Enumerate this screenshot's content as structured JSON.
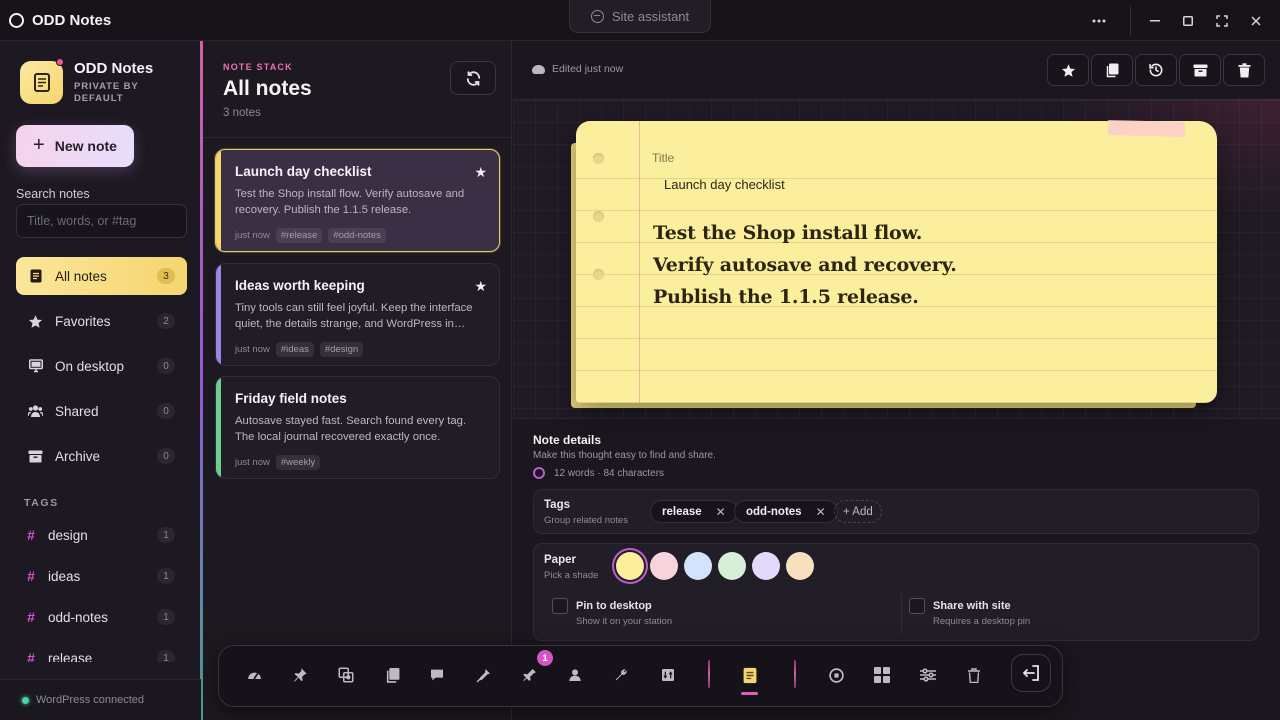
{
  "window": {
    "title": "ODD Notes",
    "site_assistant": "Site assistant"
  },
  "sidebar": {
    "brand_title": "ODD Notes",
    "brand_sub_line1": "PRIVATE BY",
    "brand_sub_line2": "DEFAULT",
    "new_note_label": "New note",
    "search_label": "Search notes",
    "search_placeholder": "Title, words, or #tag",
    "nav": [
      {
        "label": "All notes",
        "count": "3",
        "icon": "notes-icon",
        "active": true
      },
      {
        "label": "Favorites",
        "count": "2",
        "icon": "star-icon"
      },
      {
        "label": "On desktop",
        "count": "0",
        "icon": "desktop-icon"
      },
      {
        "label": "Shared",
        "count": "0",
        "icon": "shared-icon"
      },
      {
        "label": "Archive",
        "count": "0",
        "icon": "archive-icon"
      }
    ],
    "tags_heading": "TAGS",
    "tags": [
      {
        "label": "design",
        "count": "1"
      },
      {
        "label": "ideas",
        "count": "1"
      },
      {
        "label": "odd-notes",
        "count": "1"
      },
      {
        "label": "release",
        "count": "1"
      }
    ],
    "status": "WordPress connected"
  },
  "list": {
    "stack_label": "NOTE STACK",
    "title": "All notes",
    "count": "3 notes",
    "cards": [
      {
        "title": "Launch day checklist",
        "body": "Test the Shop install flow. Verify autosave and recovery. Publish the 1.1.5 release.",
        "time": "just now",
        "tags": [
          "#release",
          "#odd-notes"
        ],
        "starred": true,
        "accent": "#f5d56f"
      },
      {
        "title": "Ideas worth keeping",
        "body": "Tiny tools can still feel joyful. Keep the interface quiet, the details strange, and WordPress in…",
        "time": "just now",
        "tags": [
          "#ideas",
          "#design"
        ],
        "starred": true,
        "accent": "#9b86e8"
      },
      {
        "title": "Friday field notes",
        "body": "Autosave stayed fast. Search found every tag. The local journal recovered exactly once.",
        "time": "just now",
        "tags": [
          "#weekly"
        ],
        "starred": false,
        "accent": "#6ccf8e"
      }
    ]
  },
  "editor": {
    "edited": "Edited just now",
    "title_label": "Title",
    "title_value": "Launch day checklist",
    "lines": [
      "Test the Shop install flow.",
      "Verify autosave and recovery.",
      "Publish the 1.1.5 release."
    ],
    "details": {
      "title": "Note details",
      "subtitle": "Make this thought easy to find and share.",
      "stats": "12 words · 84 characters",
      "tags_label": "Tags",
      "tags_sub": "Group related notes",
      "tags": [
        "release",
        "odd-notes"
      ],
      "add_label": "+ Add",
      "paper_label": "Paper",
      "paper_sub": "Pick a shade",
      "paper_colors": [
        "#fbee9c",
        "#f9d3dc",
        "#d3e3fb",
        "#d5f0d6",
        "#e3dafb",
        "#f8dfc0"
      ],
      "pin_label": "Pin to desktop",
      "pin_sub": "Show it on your station",
      "share_label": "Share with site",
      "share_sub": "Requires a desktop pin"
    }
  },
  "dock": {
    "badge": "1",
    "icons": [
      "dashboard-icon",
      "pin-icon",
      "media-icon",
      "pages-icon",
      "comments-icon",
      "appearance-icon",
      "plugins-icon",
      "users-icon",
      "tools-icon",
      "import-icon",
      "notes-app-icon",
      "odd-icon",
      "apps-grid-icon",
      "settings-icon",
      "trash-icon",
      "exit-icon"
    ]
  }
}
